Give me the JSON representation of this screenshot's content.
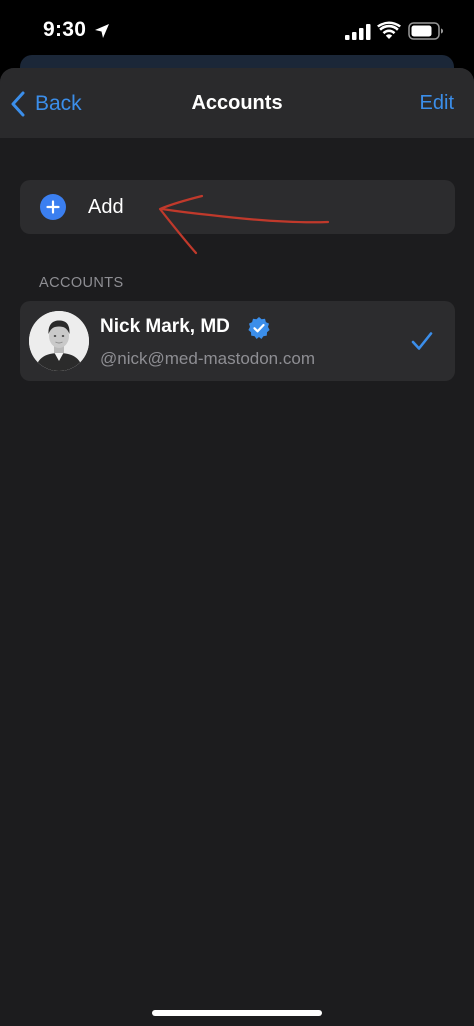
{
  "status_bar": {
    "time": "9:30",
    "icons": [
      "location-arrow-icon",
      "cellular-signal-icon",
      "wifi-icon",
      "battery-icon"
    ]
  },
  "nav": {
    "back_label": "Back",
    "title": "Accounts",
    "edit_label": "Edit"
  },
  "add": {
    "label": "Add",
    "icon": "plus-circle-icon"
  },
  "annotation": {
    "icon": "hand-drawn-arrow-icon",
    "color": "#c0392b"
  },
  "accounts": {
    "section_title": "ACCOUNTS",
    "items": [
      {
        "name": "Nick Mark, MD",
        "handle": "@nick@med-mastodon.com",
        "verified": true,
        "selected": true
      }
    ]
  },
  "colors": {
    "accent": "#3b8eea",
    "background": "#1c1c1e",
    "cell": "#2c2c2e",
    "secondary_text": "#8e8e93"
  }
}
